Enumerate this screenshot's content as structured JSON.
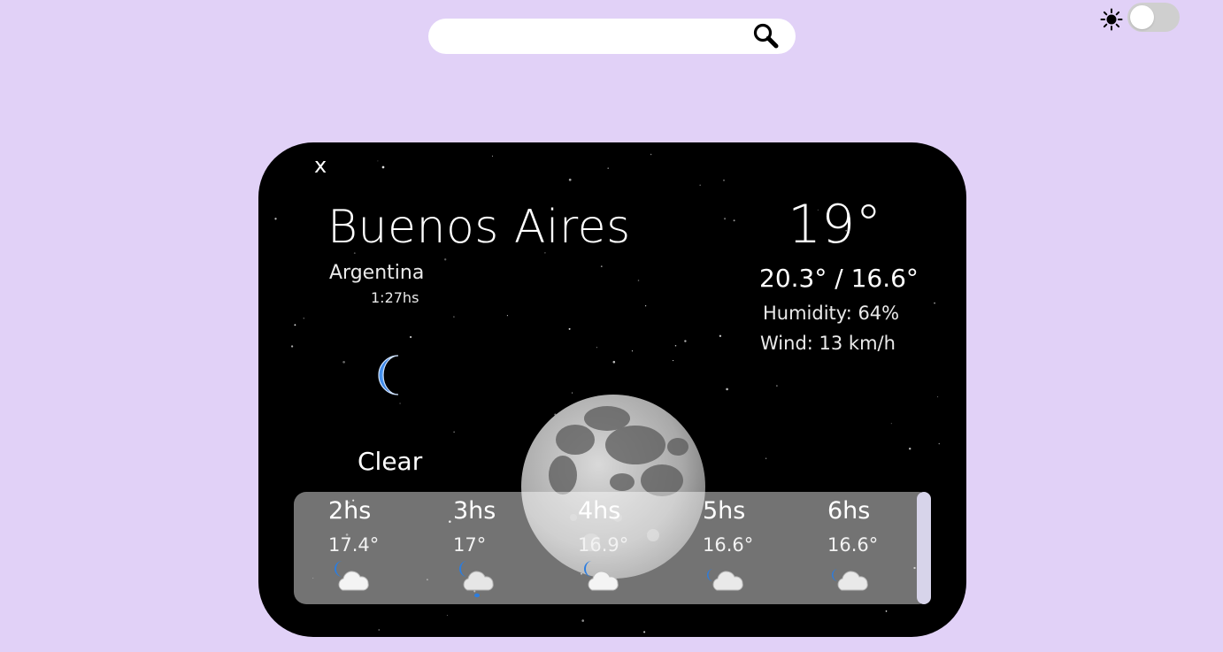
{
  "search": {
    "placeholder": "",
    "value": "",
    "icon": "search-icon"
  },
  "theme_toggle": {
    "icon": "sun-icon",
    "state": "off"
  },
  "weather": {
    "close_label": "x",
    "city": "Buenos Aires",
    "country": "Argentina",
    "local_time": "1:27hs",
    "condition_icon": "crescent-moon-icon",
    "condition": "Clear",
    "temperature": "19°",
    "max_min": "20.3° / 16.6°",
    "humidity": "Humidity: 64%",
    "wind": "Wind: 13 km/h",
    "background": "night-sky-with-moon"
  },
  "forecast": {
    "hours": [
      {
        "label": "2hs",
        "temp": "17.4°",
        "icon": "partly-cloudy-night-icon"
      },
      {
        "label": "3hs",
        "temp": "17°",
        "icon": "cloudy-night-drizzle-icon"
      },
      {
        "label": "4hs",
        "temp": "16.9°",
        "icon": "partly-cloudy-night-icon"
      },
      {
        "label": "5hs",
        "temp": "16.6°",
        "icon": "partly-cloudy-night-icon"
      },
      {
        "label": "6hs",
        "temp": "16.6°",
        "icon": "partly-cloudy-night-icon"
      }
    ]
  },
  "colors": {
    "page_background": "#e1d1f7",
    "card_background": "#000000",
    "moon_icon": "#1a6fd8",
    "forecast_panel": "rgba(255,255,255,0.45)",
    "scrollbar_thumb": "#d7d4ea"
  }
}
